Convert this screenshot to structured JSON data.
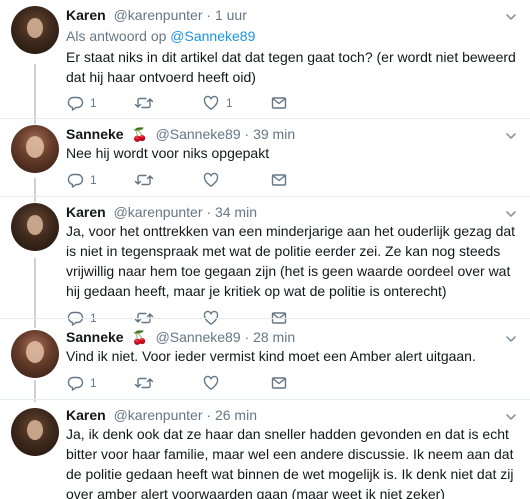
{
  "tweets": [
    {
      "name": "Karen",
      "handle": "@karenpunter",
      "time": "1 uur",
      "reply_prefix": "Als antwoord op",
      "reply_handle": "@Sanneke89",
      "text": "Er staat niks in dit artikel dat dat tegen gaat toch? (er wordt niet beweerd dat hij haar ontvoerd heeft oid)",
      "reply_count": "1",
      "like_count": "1"
    },
    {
      "name": "Sanneke",
      "emoji": "🍒",
      "handle": "@Sanneke89",
      "time": "39 min",
      "text": "Nee hij wordt voor niks opgepakt",
      "reply_count": "1"
    },
    {
      "name": "Karen",
      "handle": "@karenpunter",
      "time": "34 min",
      "text": "Ja, voor het onttrekken van een minderjarige aan het ouderlijk gezag dat is niet in tegenspraak met wat de politie eerder zei. Ze kan nog steeds vrijwillig naar hem toe gegaan zijn (het is geen waarde oordeel over wat hij gedaan heeft, maar je kritiek op wat de politie is onterecht)",
      "reply_count": "1"
    },
    {
      "name": "Sanneke",
      "emoji": "🍒",
      "handle": "@Sanneke89",
      "time": "28 min",
      "text": "Vind ik niet. Voor ieder vermist kind moet een Amber alert uitgaan.",
      "reply_count": "1"
    },
    {
      "name": "Karen",
      "handle": "@karenpunter",
      "time": "26 min",
      "text": "Ja, ik denk ook dat ze haar dan sneller hadden gevonden en dat is echt bitter voor haar familie, maar wel een andere discussie. Ik neem aan dat de politie gedaan heeft wat binnen de wet mogelijk is. Ik denk niet dat zij over amber alert voorwaarden gaan (maar weet ik niet zeker)"
    }
  ],
  "colors": {
    "text": "#14171a",
    "secondary": "#657786",
    "link": "#1b95e0",
    "divider": "#e6ecf0",
    "thread_line": "#d0d0d8",
    "cherry": "#d4213d"
  },
  "icons": {
    "reply": "reply-icon",
    "retweet": "retweet-icon",
    "like": "heart-icon",
    "message": "envelope-icon",
    "caret": "chevron-down-icon"
  }
}
